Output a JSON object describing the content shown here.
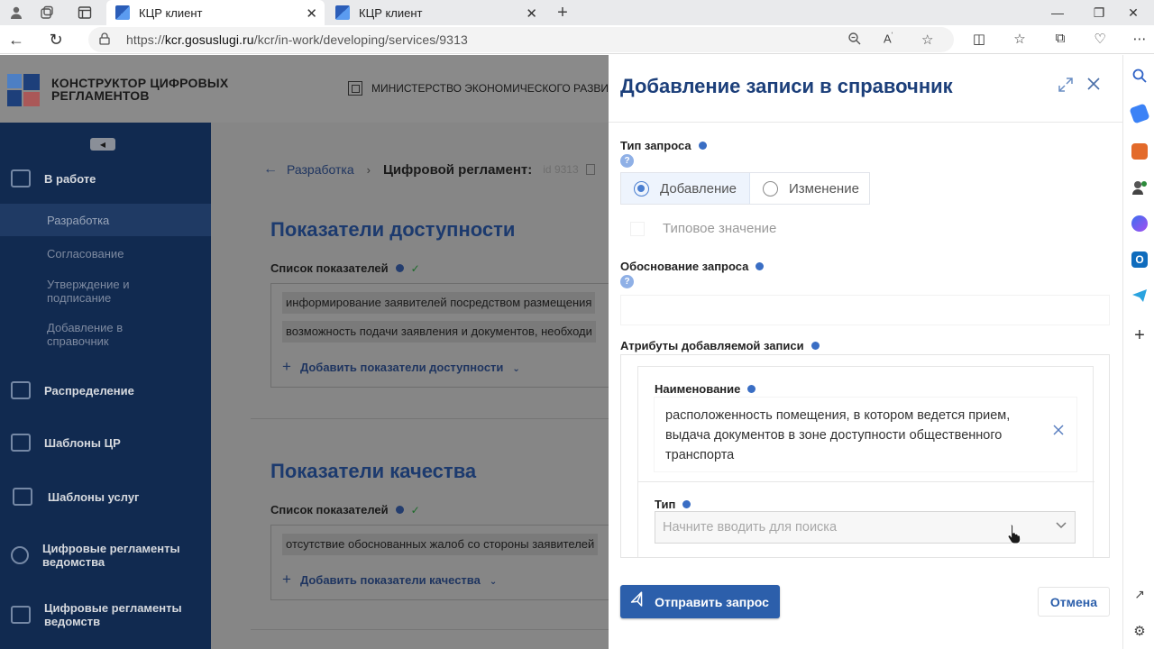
{
  "browser": {
    "tabs": [
      {
        "title": "КЦР клиент",
        "active": true
      },
      {
        "title": "КЦР клиент",
        "active": false
      }
    ],
    "url_prefix": "https://",
    "url_host": "kcr.gosuslugi.ru",
    "url_path": "/kcr/in-work/developing/services/9313"
  },
  "header": {
    "app_title": "КОНСТРУКТОР ЦИФРОВЫХ РЕГЛАМЕНТОВ",
    "ministry": "МИНИСТЕРСТВО ЭКОНОМИЧЕСКОГО РАЗВИТИЯ"
  },
  "sidebar": {
    "in_work": "В работе",
    "sub": [
      "Разработка",
      "Согласование",
      "Утверждение и подписание",
      "Добавление в справочник"
    ],
    "items": [
      "Распределение",
      "Шаблоны ЦР",
      "Шаблоны услуг",
      "Цифровые регламенты ведомства",
      "Цифровые регламенты ведомств"
    ]
  },
  "main": {
    "crumb_back": "Разработка",
    "crumb_current": "Цифровой регламент:",
    "crumb_id": "id 9313",
    "sections": [
      {
        "title": "Показатели доступности",
        "list_label": "Список показателей",
        "items": [
          "информирование заявителей посредством размещения",
          "возможность подачи заявления и документов, необходи"
        ],
        "add_label": "Добавить показатели доступности"
      },
      {
        "title": "Показатели качества",
        "list_label": "Список показателей",
        "items": [
          "отсутствие обоснованных жалоб со стороны заявителей"
        ],
        "add_label": "Добавить показатели качества"
      }
    ]
  },
  "modal": {
    "title": "Добавление записи в справочник",
    "request_type_label": "Тип запроса",
    "options": [
      "Добавление",
      "Изменение"
    ],
    "selected_option": "Добавление",
    "typical_value": "Типовое значение",
    "justification_label": "Обоснование запроса",
    "justification_value": "",
    "attributes_label": "Атрибуты добавляемой записи",
    "name_label": "Наименование",
    "name_value": "расположенность помещения, в котором ведется прием, выдача документов в зоне доступности общественного транспорта",
    "type_label": "Тип",
    "type_placeholder": "Начните вводить для поиска",
    "send_label": "Отправить запрос",
    "cancel_label": "Отмена",
    "help_glyph": "?"
  },
  "colors": {
    "primary": "#2c5fab",
    "title_blue": "#1c3f7a",
    "sidebar_bg": "#112a50",
    "overlay_gray": "#868686"
  }
}
